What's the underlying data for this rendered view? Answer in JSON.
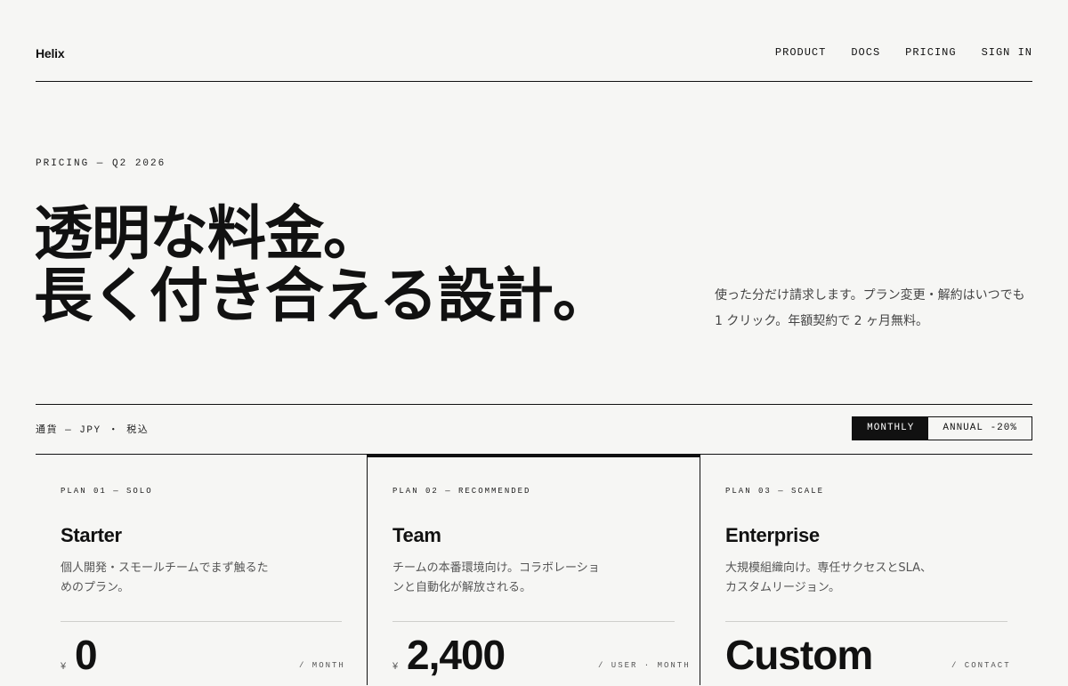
{
  "header": {
    "logo": "Helix",
    "nav": [
      "PRODUCT",
      "DOCS",
      "PRICING",
      "SIGN IN"
    ]
  },
  "hero": {
    "eyebrow": "PRICING — Q2 2026",
    "title_line1": "透明な料金。",
    "title_line2": "長く付き合える設計。",
    "description": "使った分だけ請求します。プラン変更・解約はいつでも 1 クリック。年額契約で 2 ヶ月無料。"
  },
  "billing": {
    "currency_label": "通貨 — JPY ・ 税込",
    "options": [
      "MONTHLY",
      "ANNUAL -20%"
    ],
    "selected": "MONTHLY"
  },
  "plans": [
    {
      "label": "PLAN 01 — SOLO",
      "name": "Starter",
      "description": "個人開発・スモールチームでまず触るためのプラン。",
      "currency_symbol": "¥",
      "price": "0",
      "unit": "/ MONTH"
    },
    {
      "label": "PLAN 02 — RECOMMENDED",
      "name": "Team",
      "description": "チームの本番環境向け。コラボレーションと自動化が解放される。",
      "currency_symbol": "¥",
      "price": "2,400",
      "unit": "/ USER · MONTH"
    },
    {
      "label": "PLAN 03 — SCALE",
      "name": "Enterprise",
      "description": "大規模組織向け。専任サクセスとSLA、カスタムリージョン。",
      "currency_symbol": "",
      "price": "Custom",
      "unit": "/ CONTACT"
    }
  ],
  "colors": {
    "background": "#f6f6f4",
    "ink": "#111111",
    "muted": "#555555"
  }
}
